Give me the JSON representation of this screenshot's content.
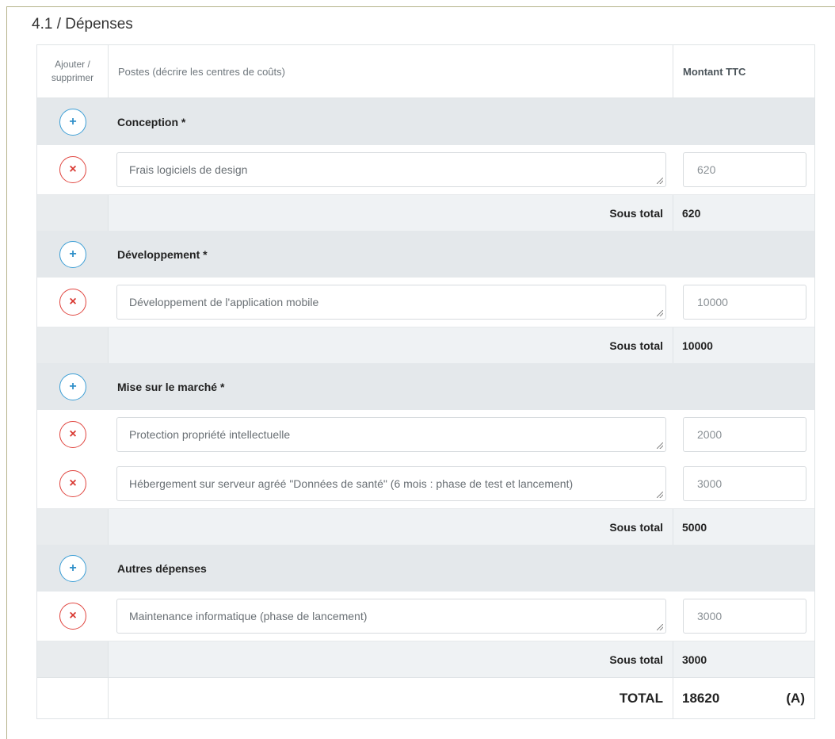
{
  "section": {
    "title": "4.1 / Dépenses"
  },
  "table": {
    "headers": {
      "action": "Ajouter / supprimer",
      "posts": "Postes (décrire les centres de coûts)",
      "amount": "Montant TTC"
    },
    "categories": [
      {
        "label": "Conception *",
        "items": [
          {
            "description": "Frais logiciels de design",
            "amount": "620"
          }
        ],
        "subtotal_label": "Sous total",
        "subtotal": "620"
      },
      {
        "label": "Développement *",
        "items": [
          {
            "description": "Développement de l'application mobile",
            "amount": "10000"
          }
        ],
        "subtotal_label": "Sous total",
        "subtotal": "10000"
      },
      {
        "label": "Mise sur le marché *",
        "items": [
          {
            "description": "Protection propriété intellectuelle",
            "amount": "2000"
          },
          {
            "description": "Hébergement sur serveur agréé \"Données de santé\" (6 mois : phase de test et lancement)",
            "amount": "3000"
          }
        ],
        "subtotal_label": "Sous total",
        "subtotal": "5000"
      },
      {
        "label": "Autres dépenses",
        "items": [
          {
            "description": "Maintenance informatique (phase de lancement)",
            "amount": "3000"
          }
        ],
        "subtotal_label": "Sous total",
        "subtotal": "3000"
      }
    ],
    "total": {
      "label": "TOTAL",
      "value": "18620",
      "ref": "(A)"
    }
  },
  "icons": {
    "add": "plus-icon",
    "remove": "times-icon"
  },
  "colors": {
    "add": "#3d9fd6",
    "remove": "#e0453f",
    "category_bg": "#e4e8eb",
    "subtotal_bg": "#eff2f4"
  }
}
